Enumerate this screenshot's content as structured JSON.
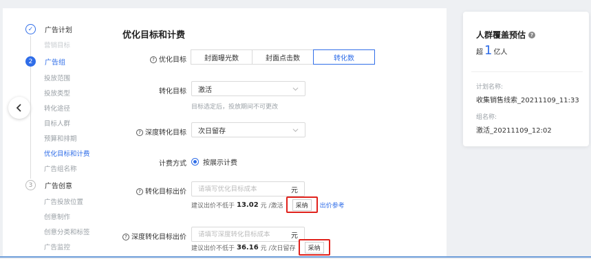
{
  "steps": {
    "plan": {
      "number": "✓",
      "title": "广告计划",
      "subs": [
        "营销目标"
      ]
    },
    "group": {
      "number": "2",
      "title": "广告组",
      "subs": [
        "投放范围",
        "投放类型",
        "转化途径",
        "目标人群",
        "预算和排期",
        "优化目标和计费",
        "广告组名称"
      ]
    },
    "creative": {
      "number": "3",
      "title": "广告创意",
      "subs": [
        "广告投放位置",
        "创意制作",
        "创意分类和标签",
        "广告监控"
      ]
    }
  },
  "form": {
    "section_title": "优化目标和计费",
    "opt_goal": {
      "label": "优化目标",
      "options": [
        "封面曝光数",
        "封面点击数",
        "转化数"
      ],
      "selected_index": 2
    },
    "conv_goal": {
      "label": "转化目标",
      "value": "激活",
      "hint": "目标选定后，投放期间不可更改"
    },
    "deep_conv_goal": {
      "label": "深度转化目标",
      "value": "次日留存"
    },
    "billing": {
      "label": "计费方式",
      "value": "按展示计费"
    },
    "conv_bid": {
      "label": "转化目标出价",
      "placeholder": "请填写优化目标成本",
      "unit": "元",
      "suggest_prefix": "建议出价不低于",
      "suggest_value": "13.02",
      "suggest_suffix": "元 /激活",
      "adopt_label": "采纳",
      "ref_link": "出价参考"
    },
    "deep_bid": {
      "label": "深度转化目标出价",
      "placeholder": "请填写深度转化目标成本",
      "unit": "元",
      "suggest_prefix": "建议出价不低于",
      "suggest_value": "36.16",
      "suggest_suffix": "元 /次日留存",
      "adopt_label": "采纳"
    }
  },
  "right_panel": {
    "title": "人群覆盖预估",
    "count_prefix": "超",
    "count_value": "1",
    "count_unit": "亿人",
    "plan_name_label": "计划名称:",
    "plan_name": "收集销售线索_20211109_11:33",
    "group_name_label": "组名称:",
    "group_name": "激活_20211109_12:02"
  },
  "colors": {
    "accent": "#2f6de8",
    "highlight_border": "#e0201a"
  }
}
